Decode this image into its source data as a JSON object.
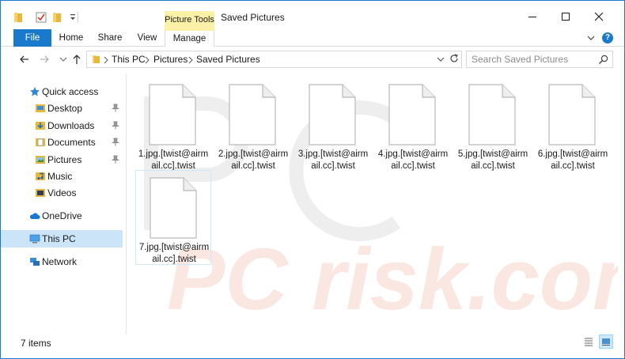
{
  "window": {
    "title": "Saved Pictures",
    "contextual_tab_group": "Picture Tools"
  },
  "ribbon": {
    "tabs": [
      {
        "label": "File"
      },
      {
        "label": "Home"
      },
      {
        "label": "Share"
      },
      {
        "label": "View"
      },
      {
        "label": "Manage"
      }
    ],
    "help_label": "?"
  },
  "address": {
    "breadcrumbs": [
      "This PC",
      "Pictures",
      "Saved Pictures"
    ]
  },
  "search": {
    "placeholder": "Search Saved Pictures"
  },
  "sidebar": {
    "quick_access": {
      "label": "Quick access",
      "icon": "star-icon",
      "items": [
        {
          "label": "Desktop",
          "icon": "desktop-folder-icon",
          "pinned": true
        },
        {
          "label": "Downloads",
          "icon": "downloads-folder-icon",
          "pinned": true
        },
        {
          "label": "Documents",
          "icon": "documents-folder-icon",
          "pinned": true
        },
        {
          "label": "Pictures",
          "icon": "pictures-folder-icon",
          "pinned": true
        },
        {
          "label": "Music",
          "icon": "music-folder-icon",
          "pinned": false
        },
        {
          "label": "Videos",
          "icon": "videos-folder-icon",
          "pinned": false
        }
      ]
    },
    "onedrive": {
      "label": "OneDrive",
      "icon": "cloud-icon"
    },
    "this_pc": {
      "label": "This PC",
      "icon": "computer-icon",
      "selected": true
    },
    "network": {
      "label": "Network",
      "icon": "network-icon"
    }
  },
  "files": [
    {
      "name_line1": "1.jpg.[twist@airm",
      "name_line2": "ail.cc].twist"
    },
    {
      "name_line1": "2.jpg.[twist@airm",
      "name_line2": "ail.cc].twist"
    },
    {
      "name_line1": "3.jpg.[twist@airm",
      "name_line2": "ail.cc].twist"
    },
    {
      "name_line1": "4.jpg.[twist@airm",
      "name_line2": "ail.cc].twist"
    },
    {
      "name_line1": "5.jpg.[twist@airm",
      "name_line2": "ail.cc].twist"
    },
    {
      "name_line1": "6.jpg.[twist@airm",
      "name_line2": "ail.cc].twist"
    },
    {
      "name_line1": "7.jpg.[twist@airm",
      "name_line2": "ail.cc].twist",
      "selected": true
    }
  ],
  "status": {
    "item_count": "7 items"
  },
  "watermark": {
    "text": "PC risk.com"
  },
  "colors": {
    "accent": "#1979ca",
    "selection": "#cce4f7",
    "contextual_tab": "#fdf1a8",
    "watermark": "#f2a08a"
  }
}
